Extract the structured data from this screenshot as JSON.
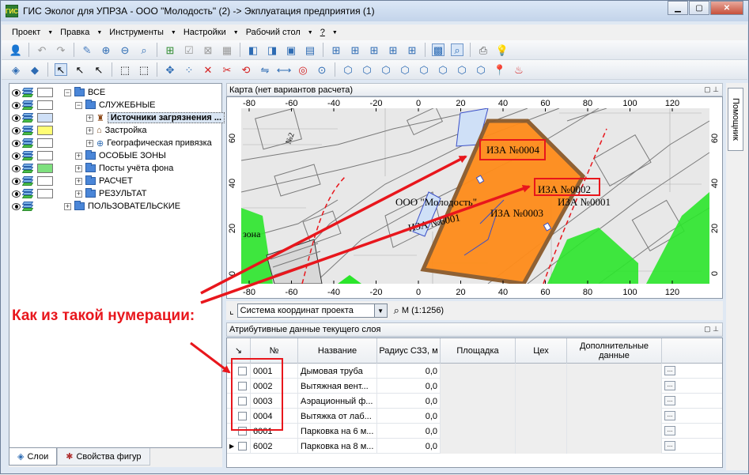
{
  "window": {
    "title": "ГИС Эколог для УПРЗА - ООО \"Молодость\" (2) -> Экплуатация предприятия (1)",
    "app_icon_text": "ГИС"
  },
  "menu": [
    "Проект",
    "Правка",
    "Инструменты",
    "Настройки",
    "Рабочий стол",
    "?"
  ],
  "layers": {
    "items": [
      {
        "label": "ВСЕ",
        "swatch": "#ffffff"
      },
      {
        "label": "СЛУЖЕБНЫЕ",
        "swatch": "#ffffff"
      },
      {
        "label": "Источники загрязнения ...",
        "swatch": "#cfe0f7",
        "selected": true
      },
      {
        "label": "Застройка",
        "swatch": "#fffd74"
      },
      {
        "label": "Географическая привязка",
        "swatch": "#ffffff"
      },
      {
        "label": "ОСОБЫЕ ЗОНЫ",
        "swatch": "#ffffff"
      },
      {
        "label": "Посты учёта фона",
        "swatch": "#7ee07e"
      },
      {
        "label": "РАСЧЕТ",
        "swatch": "#ffffff"
      },
      {
        "label": "РЕЗУЛЬТАТ",
        "swatch": "#ffffff"
      },
      {
        "label": "ПОЛЬЗОВАТЕЛЬСКИЕ",
        "swatch": null
      }
    ]
  },
  "bottom_tabs": {
    "layers": "Слои",
    "figure_props": "Свойства фигур"
  },
  "map": {
    "header": "Карта (нет вариантов расчета)",
    "x_ticks": [
      "-80",
      "-60",
      "-40",
      "-20",
      "0",
      "20",
      "40",
      "60",
      "80",
      "100",
      "120"
    ],
    "y_ticks": [
      "60",
      "40",
      "20",
      "0"
    ],
    "labels": {
      "iza4": "ИЗА №0004",
      "iza2": "ИЗА №0002",
      "iza3": "ИЗА №0003",
      "iza1": "ИЗА №0001",
      "iza6001": "ИЗА №6001",
      "org": "ООО \"Молодость\"",
      "zone": "зона",
      "n2": "№2"
    }
  },
  "coord_bar": {
    "system": "Система координат проекта",
    "scale": "М (1:1256)"
  },
  "attributes": {
    "header": "Атрибутивные данные текущего слоя",
    "columns": {
      "num": "№",
      "name": "Название",
      "radius": "Радиус СЗЗ, м",
      "site": "Площадка",
      "shop": "Цех",
      "extra": "Дополнительные данные"
    },
    "rows": [
      {
        "num": "0001",
        "name": "Дымовая труба",
        "radius": "0,0"
      },
      {
        "num": "0002",
        "name": "Вытяжная вент...",
        "radius": "0,0"
      },
      {
        "num": "0003",
        "name": "Аэрационный ф...",
        "radius": "0,0"
      },
      {
        "num": "0004",
        "name": "Вытяжка от лаб...",
        "radius": "0,0"
      },
      {
        "num": "6001",
        "name": "Парковка на 6 м...",
        "radius": "0,0"
      },
      {
        "num": "6002",
        "name": "Парковка на 8 м...",
        "radius": "0,0"
      }
    ],
    "ellipsis": "..."
  },
  "side_panel": {
    "helper_tab": "Помощник"
  },
  "annotation": {
    "text": "Как из такой нумерации:"
  },
  "colors": {
    "annotation_red": "#e8161c",
    "building_orange": "#ff8c1a",
    "zone_green": "#2be52b"
  }
}
